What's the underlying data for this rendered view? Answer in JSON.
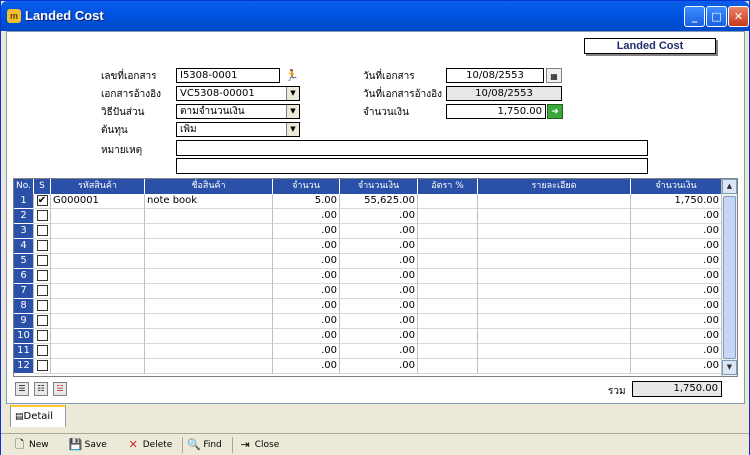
{
  "window": {
    "title": "Landed Cost",
    "icon": "app-icon",
    "buttons": [
      "minimize-icon",
      "maximize-icon",
      "close-icon"
    ]
  },
  "badge": "Landed Cost",
  "form": {
    "doc_no_label": "เลขที่เอกสาร",
    "doc_no": "I5308-0001",
    "ref_doc_label": "เอกสารอ้างอิง",
    "ref_doc": "VC5308-00001",
    "method_label": "วิธีปันส่วน",
    "method": "ตามจำนวนเงิน",
    "cost_label": "ต้นทุน",
    "cost": "เพิ่ม",
    "remark_label": "หมายเหตุ",
    "remark1": "",
    "remark2": "",
    "doc_date_label": "วันที่เอกสาร",
    "doc_date": "10/08/2553",
    "ref_date_label": "วันที่เอกสารอ้างอิง",
    "ref_date": "10/08/2553",
    "amount_label": "จำนวนเงิน",
    "amount": "1,750.00"
  },
  "grid": {
    "headers": [
      "No.",
      "S",
      "รหัสสินค้า",
      "ชื่อสินค้า",
      "จำนวน",
      "จำนวนเงิน",
      "อัตรา %",
      "รายละเอียด",
      "จำนวนเงิน"
    ],
    "rows": [
      {
        "no": "1",
        "checked": "✔",
        "code": "G000001",
        "name": "note book",
        "qty": "5.00",
        "amount": "55,625.00",
        "rate": "",
        "detail": "",
        "total": "1,750.00"
      },
      {
        "no": "2",
        "checked": "",
        "code": "",
        "name": "",
        "qty": ".00",
        "amount": ".00",
        "rate": "",
        "detail": "",
        "total": ".00"
      },
      {
        "no": "3",
        "checked": "",
        "code": "",
        "name": "",
        "qty": ".00",
        "amount": ".00",
        "rate": "",
        "detail": "",
        "total": ".00"
      },
      {
        "no": "4",
        "checked": "",
        "code": "",
        "name": "",
        "qty": ".00",
        "amount": ".00",
        "rate": "",
        "detail": "",
        "total": ".00"
      },
      {
        "no": "5",
        "checked": "",
        "code": "",
        "name": "",
        "qty": ".00",
        "amount": ".00",
        "rate": "",
        "detail": "",
        "total": ".00"
      },
      {
        "no": "6",
        "checked": "",
        "code": "",
        "name": "",
        "qty": ".00",
        "amount": ".00",
        "rate": "",
        "detail": "",
        "total": ".00"
      },
      {
        "no": "7",
        "checked": "",
        "code": "",
        "name": "",
        "qty": ".00",
        "amount": ".00",
        "rate": "",
        "detail": "",
        "total": ".00"
      },
      {
        "no": "8",
        "checked": "",
        "code": "",
        "name": "",
        "qty": ".00",
        "amount": ".00",
        "rate": "",
        "detail": "",
        "total": ".00"
      },
      {
        "no": "9",
        "checked": "",
        "code": "",
        "name": "",
        "qty": ".00",
        "amount": ".00",
        "rate": "",
        "detail": "",
        "total": ".00"
      },
      {
        "no": "10",
        "checked": "",
        "code": "",
        "name": "",
        "qty": ".00",
        "amount": ".00",
        "rate": "",
        "detail": "",
        "total": ".00"
      },
      {
        "no": "11",
        "checked": "",
        "code": "",
        "name": "",
        "qty": ".00",
        "amount": ".00",
        "rate": "",
        "detail": "",
        "total": ".00"
      },
      {
        "no": "12",
        "checked": "",
        "code": "",
        "name": "",
        "qty": ".00",
        "amount": ".00",
        "rate": "",
        "detail": "",
        "total": ".00"
      }
    ],
    "total_label": "รวม",
    "total": "1,750.00"
  },
  "tabs": [
    "Detail"
  ],
  "toolbar": {
    "new": "New",
    "save": "Save",
    "delete": "Delete",
    "find": "Find",
    "close": "Close"
  }
}
